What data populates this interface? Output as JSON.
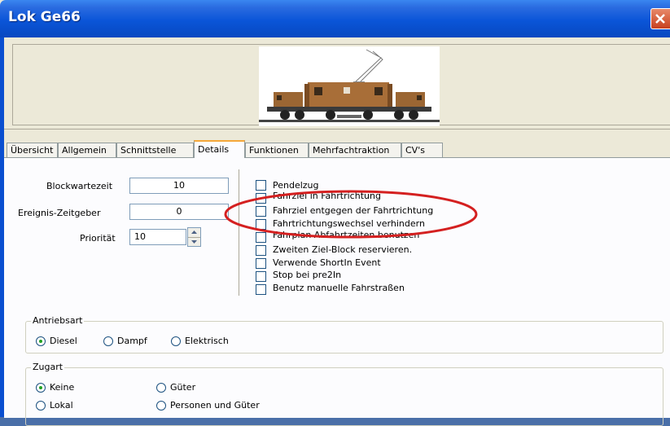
{
  "window": {
    "title": "Lok Ge66"
  },
  "tabs": [
    {
      "label": "Übersicht",
      "active": false
    },
    {
      "label": "Allgemein",
      "active": false
    },
    {
      "label": "Schnittstelle",
      "active": false
    },
    {
      "label": "Details",
      "active": true
    },
    {
      "label": "Funktionen",
      "active": false
    },
    {
      "label": "Mehrfachtraktion",
      "active": false
    },
    {
      "label": "CV's",
      "active": false
    }
  ],
  "details": {
    "blockwartezeit": {
      "label": "Blockwartezeit",
      "value": "10"
    },
    "ereignis": {
      "label": "Ereignis-Zeitgeber",
      "value": "0"
    },
    "prioritaet": {
      "label": "Priorität",
      "value": "10"
    }
  },
  "checkboxes": [
    {
      "label": "Pendelzug",
      "checked": false
    },
    {
      "label": "Fahrziel in Fahrtrichtung",
      "checked": false
    },
    {
      "label": "Fahrziel entgegen der Fahrtrichtung",
      "checked": false
    },
    {
      "label": "Fahrtrichtungswechsel verhindern",
      "checked": false
    },
    {
      "label": "Fahrplan Abfahrtzeiten benutzen",
      "checked": false
    },
    {
      "label": "Zweiten Ziel-Block reservieren.",
      "checked": false
    },
    {
      "label": "Verwende ShortIn Event",
      "checked": false
    },
    {
      "label": "Stop bei pre2In",
      "checked": false
    },
    {
      "label": "Benutz manuelle Fahrstraßen",
      "checked": false
    }
  ],
  "antriebsart": {
    "title": "Antriebsart",
    "options": [
      {
        "label": "Diesel",
        "selected": true
      },
      {
        "label": "Dampf",
        "selected": false
      },
      {
        "label": "Elektrisch",
        "selected": false
      }
    ]
  },
  "zugart": {
    "title": "Zugart",
    "options": [
      {
        "label": "Keine",
        "selected": true
      },
      {
        "label": "Güter",
        "selected": false
      },
      {
        "label": "Lokal",
        "selected": false
      },
      {
        "label": "Personen und Güter",
        "selected": false
      }
    ]
  },
  "colors": {
    "titlebar": "#0a55d8",
    "annotation": "#d42020",
    "dialog": "#ece9d8"
  }
}
